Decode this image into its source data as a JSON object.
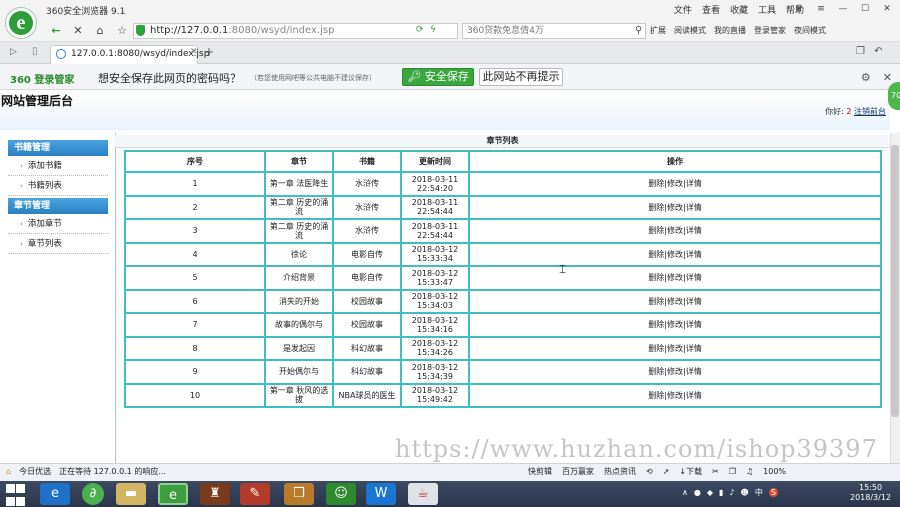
{
  "browser": {
    "title": "360安全浏览器 9.1",
    "menu": [
      "文件",
      "查看",
      "收藏",
      "工具",
      "帮助"
    ],
    "url_host": "http://127.0.0.1",
    "url_rest": ":8080/wsyd/index.jsp",
    "search_placeholder": "360贷款免息倩4万",
    "right_buttons": [
      "扩展",
      "阅读模式",
      "我的直播",
      "登录管家",
      "夜间模式"
    ],
    "tab_title": "127.0.0.1:8080/wsyd/index.jsp",
    "new_tab": "+"
  },
  "password_bar": {
    "brand": "360 登录管家",
    "question": "想安全保存此网页的密码吗？",
    "note": "（若您使用网吧等公共电脑不建议保存）",
    "save_label": "安全保存",
    "no_more_label": "此网站不再提示"
  },
  "page": {
    "title": "网站管理后台",
    "user_prefix": "你好:",
    "user_number": "2",
    "logout_label": "注销前台",
    "side_float": "70"
  },
  "sidebar": {
    "groups": [
      {
        "title": "书籍管理",
        "items": [
          "添加书籍",
          "书籍列表"
        ]
      },
      {
        "title": "章节管理",
        "items": [
          "添加章节",
          "章节列表"
        ]
      }
    ]
  },
  "table": {
    "caption": "章节列表",
    "headers": [
      "序号",
      "章节",
      "书籍",
      "更新时间",
      "操作"
    ],
    "op_labels": [
      "删除",
      "修改",
      "详情"
    ],
    "rows": [
      [
        "1",
        "第一章 法医降生",
        "水浒传",
        "2018-03-11 22:54:20"
      ],
      [
        "2",
        "第二章 历史的涌流",
        "水浒传",
        "2018-03-11 22:54:44"
      ],
      [
        "3",
        "第二章 历史的涌流",
        "水浒传",
        "2018-03-11 22:54:44"
      ],
      [
        "4",
        "徐论",
        "电影自传",
        "2018-03-12 15:33:34"
      ],
      [
        "5",
        "介绍背景",
        "电影自传",
        "2018-03-12 15:33:47"
      ],
      [
        "6",
        "消失的开始",
        "校园故事",
        "2018-03-12 15:34:03"
      ],
      [
        "7",
        "故事的偶尔与",
        "校园故事",
        "2018-03-12 15:34:16"
      ],
      [
        "8",
        "是发起因",
        "科幻故事",
        "2018-03-12 15:34:26"
      ],
      [
        "9",
        "开始偶尔与",
        "科幻故事",
        "2018-03-12 15:34:39"
      ],
      [
        "10",
        "第一章 秋风的选拔",
        "NBA球员的医生",
        "2018-03-12 15:49:42"
      ]
    ]
  },
  "watermark": "https://www.huzhan.com/ishop39397",
  "status": {
    "left_items": [
      "今日优选",
      "正在等待 127.0.0.1 的响应..."
    ],
    "right_items": [
      "快剪辑",
      "百万赢家",
      "热点资讯",
      "下载",
      "100%"
    ]
  },
  "taskbar": {
    "tray_items": [
      "中",
      "S"
    ],
    "time": "15:50",
    "date": "2018/3/12"
  },
  "colors": {
    "table_border": "#3fbfbf",
    "sidebar_header": "#2b7fc4",
    "save_button": "#3aa63e"
  }
}
